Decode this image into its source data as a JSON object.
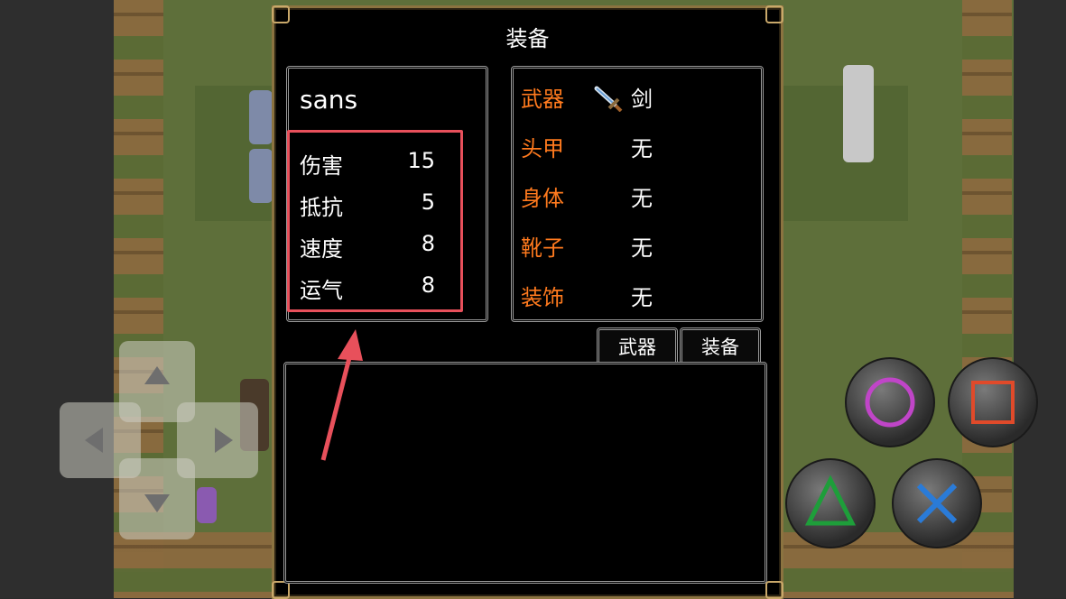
{
  "dialog": {
    "title": "装备"
  },
  "character": {
    "name": "sans",
    "stats": [
      {
        "label": "伤害",
        "value": "15"
      },
      {
        "label": "抵抗",
        "value": "5"
      },
      {
        "label": "速度",
        "value": "8"
      },
      {
        "label": "运气",
        "value": "8"
      }
    ]
  },
  "equipment": [
    {
      "slot": "武器",
      "item": "剑",
      "icon": "sword-icon"
    },
    {
      "slot": "头甲",
      "item": "无"
    },
    {
      "slot": "身体",
      "item": "无"
    },
    {
      "slot": "靴子",
      "item": "无"
    },
    {
      "slot": "装饰",
      "item": "无"
    }
  ],
  "tabs": [
    {
      "label": "武器"
    },
    {
      "label": "装备"
    }
  ],
  "colors": {
    "slot_label": "#ff7a1e",
    "highlight_box": "#e8505b",
    "circle_button": "#c045c8",
    "square_button": "#e04a2a",
    "triangle_button": "#1e9e3a",
    "cross_button": "#2a7bd8"
  },
  "controls": {
    "dpad": [
      "up-arrow-icon",
      "down-arrow-icon",
      "left-arrow-icon",
      "right-arrow-icon"
    ],
    "buttons": [
      "circle-icon",
      "square-icon",
      "triangle-icon",
      "cross-icon"
    ]
  }
}
